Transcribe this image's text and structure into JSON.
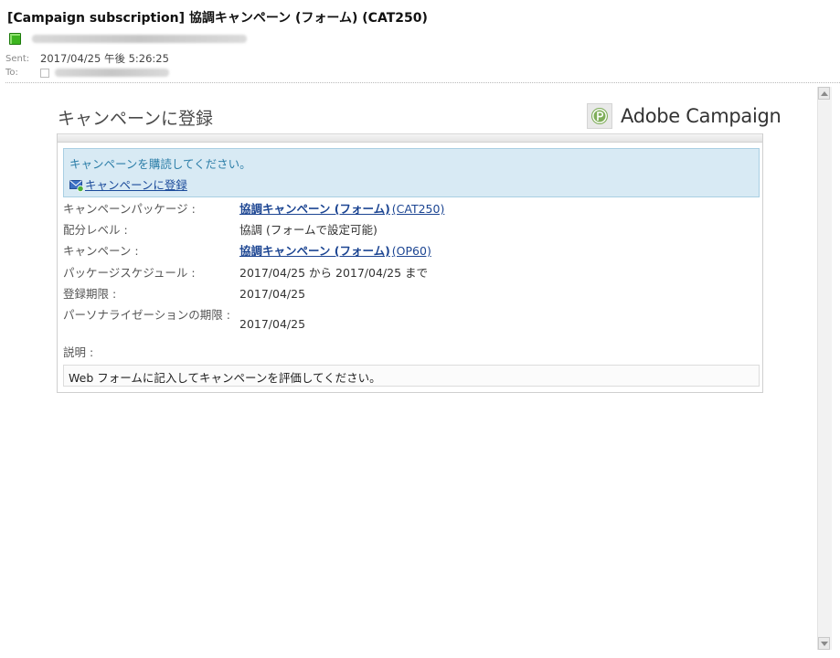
{
  "email": {
    "subject": "[Campaign subscription]  協調キャンペーン (フォーム)  (CAT250)",
    "sent_label": "Sent:",
    "sent_value": "2017/04/25 午後 5:26:25",
    "to_label": "To:"
  },
  "body": {
    "title": "キャンペーンに登録",
    "brand": "Adobe Campaign",
    "notice": {
      "text": "キャンペーンを購読してください。",
      "link": "キャンペーンに登録"
    },
    "rows": [
      {
        "label": "キャンペーンパッケージ :",
        "link": "協調キャンペーン (フォーム)",
        "code": "(CAT250)"
      },
      {
        "label": "配分レベル :",
        "value": "協調 (フォームで設定可能)"
      },
      {
        "label": "キャンペーン :",
        "link": "協調キャンペーン (フォーム)",
        "code": "(OP60)"
      },
      {
        "label": "パッケージスケジュール :",
        "value": "2017/04/25 から 2017/04/25 まで"
      },
      {
        "label": "登録期限 :",
        "value": "2017/04/25"
      },
      {
        "label": "パーソナライゼーションの期限 :",
        "value": "2017/04/25"
      },
      {
        "label": "説明 :"
      }
    ],
    "description": "Web フォームに記入してキャンペーンを評価してください。"
  },
  "colors": {
    "notice_bg": "#d8eaf4",
    "notice_text": "#2c7ea8",
    "link": "#1c4592",
    "sender_icon": "#3db51f"
  },
  "icons": [
    "contact-icon",
    "mail-subscribe-icon",
    "adobe-campaign-logo-icon",
    "scroll-up-icon",
    "scroll-down-icon"
  ]
}
